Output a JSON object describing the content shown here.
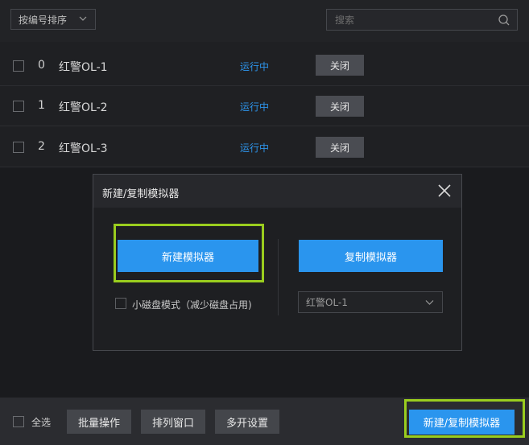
{
  "toolbar": {
    "sort_label": "按编号排序",
    "search_placeholder": "搜索"
  },
  "emulators": [
    {
      "index": "0",
      "name": "红警OL-1",
      "status": "运行中",
      "action": "关闭"
    },
    {
      "index": "1",
      "name": "红警OL-2",
      "status": "运行中",
      "action": "关闭"
    },
    {
      "index": "2",
      "name": "红警OL-3",
      "status": "运行中",
      "action": "关闭"
    }
  ],
  "dialog": {
    "title": "新建/复制模拟器",
    "new_button": "新建模拟器",
    "copy_button": "复制模拟器",
    "small_disk_label": "小磁盘模式（减少磁盘占用)",
    "copy_source_selected": "红警OL-1"
  },
  "bottom": {
    "select_all": "全选",
    "batch": "批量操作",
    "arrange": "排列窗口",
    "multi_settings": "多开设置",
    "new_copy": "新建/复制模拟器"
  },
  "colors": {
    "accent": "#2a95ee",
    "status": "#2d94ea",
    "highlight": "#9acd1e"
  }
}
